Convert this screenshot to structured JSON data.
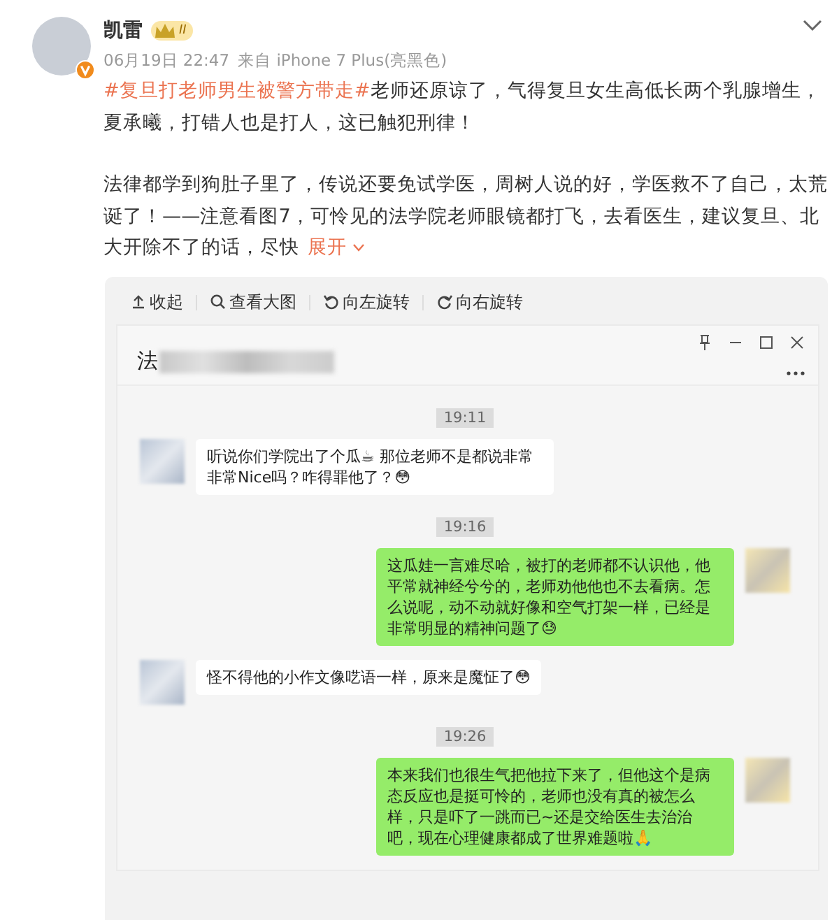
{
  "post": {
    "author": "凯雷",
    "badge_level": "II",
    "verified": true,
    "date": "06月19日 22:47",
    "source": "来自 iPhone 7 Plus(亮黑色)",
    "paragraphs": [
      {
        "hashtag": "#复旦打老师男生被警方带走#",
        "text": "老师还原谅了，气得复旦女生高低长两个乳腺增生，夏承曦，打错人也是打人，这已触犯刑律！"
      },
      {
        "text": "法律都学到狗肚子里了，传说还要免试学医，周树人说的好，学医救不了自己，太荒诞了！——注意看图7，可怜见的法学院老师眼镜都打飞，去看医生，建议复旦、北大开除不了的话，尽快",
        "more": "展开"
      }
    ]
  },
  "image_toolbar": [
    {
      "kind": "collapse",
      "label": "收起"
    },
    {
      "kind": "zoom",
      "label": "查看大图"
    },
    {
      "kind": "rotate-left",
      "label": "向左旋转"
    },
    {
      "kind": "rotate-right",
      "label": "向右旋转"
    }
  ],
  "chat_window": {
    "title": "法",
    "messages": [
      {
        "kind": "time",
        "text": "19:11"
      },
      {
        "kind": "incoming",
        "text": "听说你们学院出了个瓜☕ 那位老师不是都说非常非常Nice吗？咋得罪他了？😳"
      },
      {
        "kind": "time",
        "text": "19:16"
      },
      {
        "kind": "outgoing",
        "text": "这瓜娃一言难尽哈，被打的老师都不认识他，他平常就神经兮兮的，老师劝他他也不去看病。怎么说呢，动不动就好像和空气打架一样，已经是非常明显的精神问题了😓"
      },
      {
        "kind": "incoming",
        "text": "怪不得他的小作文像呓语一样，原来是魔怔了😳"
      },
      {
        "kind": "time",
        "text": "19:26"
      },
      {
        "kind": "outgoing",
        "text": "本来我们也很生气把他拉下来了，但他这个是病态反应也是挺可怜的，老师也没有真的被怎么样，只是吓了一跳而已~还是交给医生去治治吧，现在心理健康都成了世界难题啦🙏"
      }
    ]
  }
}
